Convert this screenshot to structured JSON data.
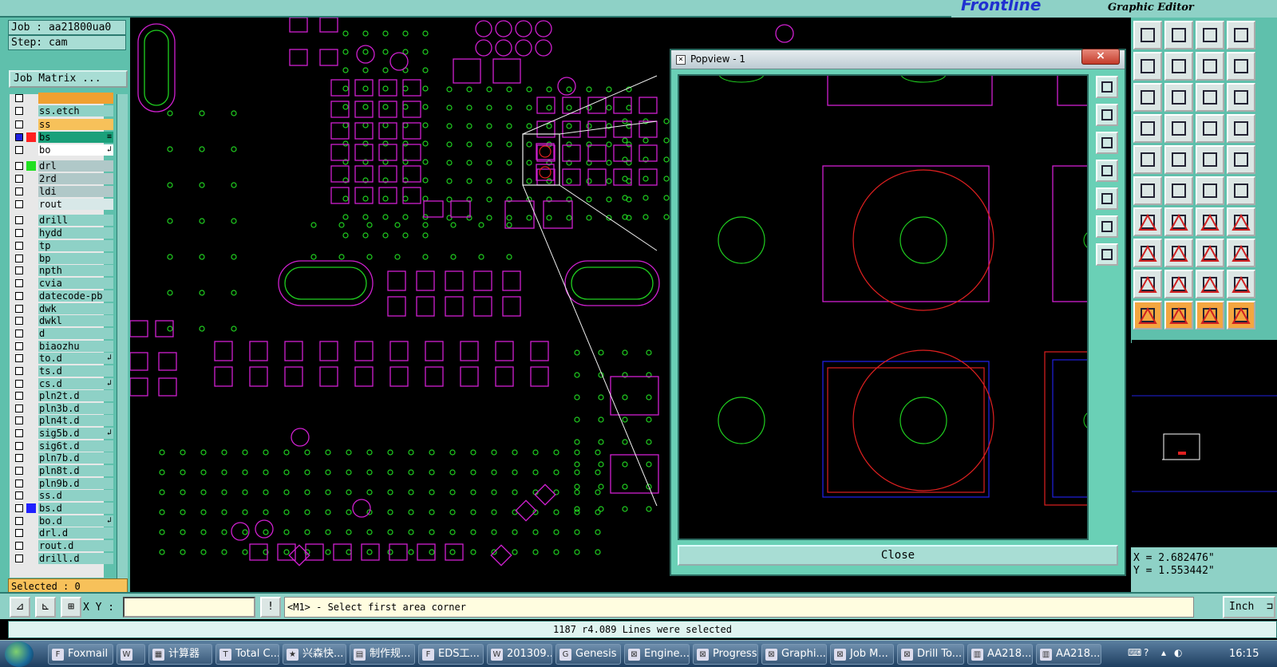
{
  "header": {
    "brand": "Frontline",
    "subtitle": "Graphic Editor"
  },
  "job": {
    "job_label": "Job : aa21800ua0",
    "step_label": "Step: cam",
    "matrix_button": "Job Matrix ..."
  },
  "layers": [
    {
      "name": "",
      "color": "#f0a030"
    },
    {
      "name": "ss.etch"
    },
    {
      "name": "ss",
      "color": "#f7c15a"
    },
    {
      "name": "bs",
      "color": "#1aa07a",
      "swatch": "#ff2020",
      "selected": true,
      "marker": "≡"
    },
    {
      "name": "bo",
      "color": "#ffffff",
      "marker": "↲"
    },
    {
      "name": "drl",
      "swatch": "#20e020",
      "color": "#b0c8c8"
    },
    {
      "name": "2rd",
      "color": "#b0c8c8"
    },
    {
      "name": "ldi",
      "color": "#b0c8c8"
    },
    {
      "name": "rout",
      "color": "#d8e8e8"
    },
    {
      "name": "drill"
    },
    {
      "name": "hydd"
    },
    {
      "name": "tp"
    },
    {
      "name": "bp"
    },
    {
      "name": "npth"
    },
    {
      "name": "cvia"
    },
    {
      "name": "datecode-pb"
    },
    {
      "name": "dwk"
    },
    {
      "name": "dwkl"
    },
    {
      "name": "d"
    },
    {
      "name": "biaozhu"
    },
    {
      "name": "to.d",
      "marker": "↲"
    },
    {
      "name": "ts.d"
    },
    {
      "name": "cs.d",
      "marker": "↲"
    },
    {
      "name": "pln2t.d"
    },
    {
      "name": "pln3b.d"
    },
    {
      "name": "pln4t.d"
    },
    {
      "name": "sig5b.d",
      "marker": "↲"
    },
    {
      "name": "sig6t.d"
    },
    {
      "name": "pln7b.d"
    },
    {
      "name": "pln8t.d"
    },
    {
      "name": "pln9b.d"
    },
    {
      "name": "ss.d"
    },
    {
      "name": "bs.d",
      "swatch": "#2020ff"
    },
    {
      "name": "bo.d",
      "marker": "↲"
    },
    {
      "name": "drl.d"
    },
    {
      "name": "rout.d"
    },
    {
      "name": "drill.d"
    }
  ],
  "selected_label": "Selected : 0",
  "popview": {
    "title": "Popview - 1",
    "close_x": "×",
    "close_button": "Close"
  },
  "command": {
    "xy_label": "X Y :",
    "xy_value": "",
    "prompt_text": "<M1> - Select first area corner",
    "units": "Inch",
    "units_arrow": "⊐"
  },
  "coords": {
    "x": "X = 2.682476\"",
    "y": "Y = 1.553442\""
  },
  "status_text": "1187 r4.089 Lines were selected",
  "taskbar": {
    "items": [
      {
        "label": "Foxmail",
        "icon": "F"
      },
      {
        "label": "",
        "icon": "W"
      },
      {
        "label": "计算器",
        "icon": "▦"
      },
      {
        "label": "Total C...",
        "icon": "T"
      },
      {
        "label": "兴森快...",
        "icon": "★"
      },
      {
        "label": "制作规...",
        "icon": "▤"
      },
      {
        "label": "EDS工...",
        "icon": "F"
      },
      {
        "label": "201309...",
        "icon": "W"
      },
      {
        "label": "Genesis",
        "icon": "G"
      },
      {
        "label": "Engine...",
        "icon": "⊠"
      },
      {
        "label": "Progress",
        "icon": "⊠"
      },
      {
        "label": "Graphi...",
        "icon": "⊠"
      },
      {
        "label": "Job M...",
        "icon": "⊠"
      },
      {
        "label": "Drill To...",
        "icon": "⊠"
      },
      {
        "label": "AA218...",
        "icon": "▥"
      },
      {
        "label": "AA218...",
        "icon": "▥"
      }
    ],
    "clock": "16:15"
  },
  "colors": {
    "panel": "#5fc0ac",
    "pad": "#d020d0",
    "drill": "#20d020",
    "sel": "#f0f0f0",
    "selred": "#e02020",
    "selblue": "#2020e0"
  }
}
